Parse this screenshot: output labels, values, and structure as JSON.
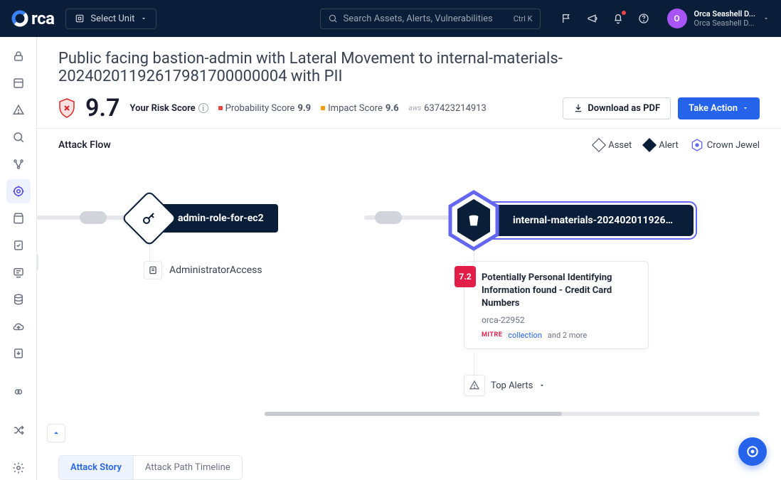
{
  "header": {
    "logo_text": "rca",
    "unit_label": "Select Unit",
    "search_placeholder": "Search Assets, Alerts, Vulnerabilities",
    "search_shortcut": "Ctrl K",
    "user_line1": "Orca Seashell D...",
    "user_line2": "Orca Seashell D...",
    "avatar_initial": "O"
  },
  "page": {
    "title": "Public facing bastion-admin with Lateral Movement to internal-materials-20240201192617981700000004 with PII",
    "big_score": "9.7",
    "risk_label": "Your Risk Score",
    "prob_label": "Probability Score",
    "prob_value": "9.9",
    "impact_label": "Impact Score",
    "impact_value": "9.6",
    "cloud_provider": "aws",
    "account_id": "637423214913",
    "download_label": "Download as PDF",
    "action_label": "Take Action"
  },
  "flow": {
    "title": "Attack Flow",
    "legend_asset": "Asset",
    "legend_alert": "Alert",
    "legend_crown": "Crown Jewel",
    "node1_label": "admin-role-for-ec2",
    "node2_label": "internal-materials-20240201192617...",
    "sub_label": "AdministratorAccess",
    "finding": {
      "severity": "7.2",
      "title": "Potentially Personal Identifying Information found - Credit Card Numbers",
      "id": "orca-22952",
      "mitre": "MITRE",
      "tag1": "collection",
      "more": "and 2 more"
    },
    "top_alerts_label": "Top Alerts"
  },
  "tabs": {
    "story": "Attack Story",
    "timeline": "Attack Path Timeline"
  }
}
